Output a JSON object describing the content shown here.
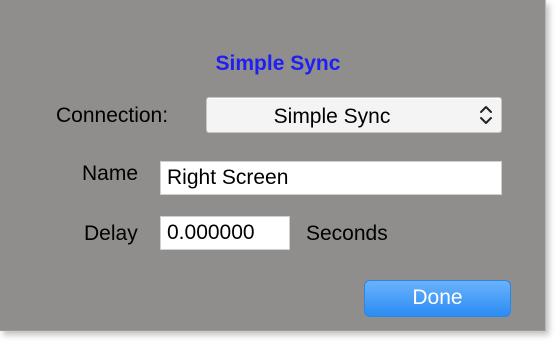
{
  "dialog": {
    "title": "Simple Sync",
    "connection_label": "Connection:",
    "connection_value": "Simple Sync",
    "name_label": "Name",
    "name_value": "Right Screen",
    "delay_label": "Delay",
    "delay_value": "0.000000",
    "seconds_label": "Seconds",
    "done_label": "Done"
  },
  "icons": {
    "select_arrows": "chevron-up-down-icon"
  },
  "colors": {
    "background": "#8f8e8d",
    "title": "#1e1ef5",
    "done_button": "#2a8cf3"
  }
}
